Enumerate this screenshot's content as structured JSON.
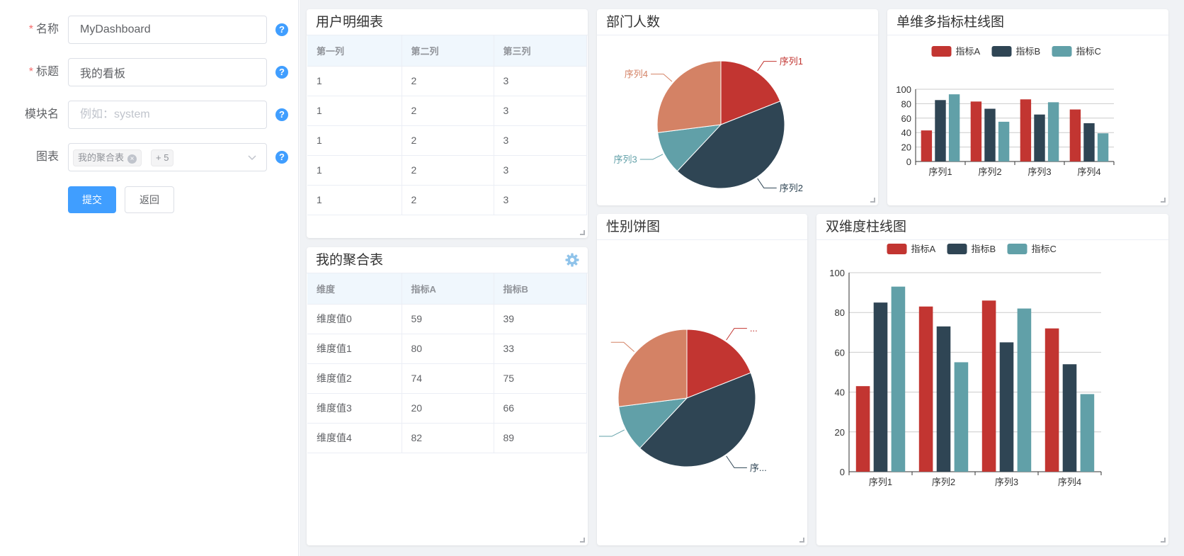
{
  "form": {
    "fields": [
      {
        "label": "名称",
        "required": true,
        "value": "MyDashboard",
        "placeholder": ""
      },
      {
        "label": "标题",
        "required": true,
        "value": "我的看板",
        "placeholder": ""
      },
      {
        "label": "模块名",
        "required": false,
        "value": "",
        "placeholder": "例如：system"
      }
    ],
    "charts_field": {
      "label": "图表",
      "tag": "我的聚合表",
      "more": "+ 5"
    },
    "required_mark": "*",
    "help_glyph": "?",
    "submit_label": "提交",
    "back_label": "返回"
  },
  "dashboard": {
    "user_table": {
      "title": "用户明细表",
      "columns": [
        "第一列",
        "第二列",
        "第三列"
      ],
      "rows": [
        [
          "1",
          "2",
          "3"
        ],
        [
          "1",
          "2",
          "3"
        ],
        [
          "1",
          "2",
          "3"
        ],
        [
          "1",
          "2",
          "3"
        ],
        [
          "1",
          "2",
          "3"
        ]
      ]
    },
    "agg_table": {
      "title": "我的聚合表",
      "columns": [
        "维度",
        "指标A",
        "指标B"
      ],
      "rows": [
        [
          "维度值0",
          "59",
          "39"
        ],
        [
          "维度值1",
          "80",
          "33"
        ],
        [
          "维度值2",
          "74",
          "75"
        ],
        [
          "维度值3",
          "20",
          "66"
        ],
        [
          "维度值4",
          "82",
          "89"
        ]
      ]
    },
    "dept_pie": {
      "title": "部门人数"
    },
    "gender_pie": {
      "title": "性别饼图",
      "label_top": "...",
      "label_bottom": "序..."
    },
    "single_bar": {
      "title": "单维多指标柱线图"
    },
    "double_bar": {
      "title": "双维度柱线图"
    }
  },
  "colors": {
    "accent": "#409eff",
    "red": "#c23531",
    "navy": "#2f4554",
    "teal": "#61a0a8",
    "orange": "#d48265"
  },
  "chart_data": [
    {
      "type": "pie",
      "title": "部门人数",
      "labels": [
        "序列1",
        "序列2",
        "序列3",
        "序列4"
      ],
      "values": [
        19,
        43,
        11,
        27
      ],
      "colors": [
        "#c23531",
        "#2f4554",
        "#61a0a8",
        "#d48265"
      ]
    },
    {
      "type": "pie",
      "title": "性别饼图",
      "labels": [
        "...",
        "序...",
        "",
        ""
      ],
      "values": [
        19,
        43,
        11,
        27
      ],
      "colors": [
        "#c23531",
        "#2f4554",
        "#61a0a8",
        "#d48265"
      ]
    },
    {
      "type": "bar",
      "title": "单维多指标柱线图",
      "categories": [
        "序列1",
        "序列2",
        "序列3",
        "序列4"
      ],
      "series": [
        {
          "name": "指标A",
          "values": [
            43,
            83,
            86,
            72
          ]
        },
        {
          "name": "指标B",
          "values": [
            85,
            73,
            65,
            53
          ]
        },
        {
          "name": "指标C",
          "values": [
            93,
            55,
            82,
            39
          ]
        }
      ],
      "yticks": [
        0,
        20,
        40,
        60,
        80,
        100
      ],
      "ylim": [
        0,
        100
      ],
      "legend": "top-center"
    },
    {
      "type": "bar",
      "title": "双维度柱线图",
      "categories": [
        "序列1",
        "序列2",
        "序列3",
        "序列4"
      ],
      "series": [
        {
          "name": "指标A",
          "values": [
            43,
            83,
            86,
            72
          ]
        },
        {
          "name": "指标B",
          "values": [
            85,
            73,
            65,
            54
          ]
        },
        {
          "name": "指标C",
          "values": [
            93,
            55,
            82,
            39
          ]
        }
      ],
      "yticks": [
        0,
        20,
        40,
        60,
        80,
        100
      ],
      "ylim": [
        0,
        100
      ],
      "legend": "top-center"
    }
  ]
}
